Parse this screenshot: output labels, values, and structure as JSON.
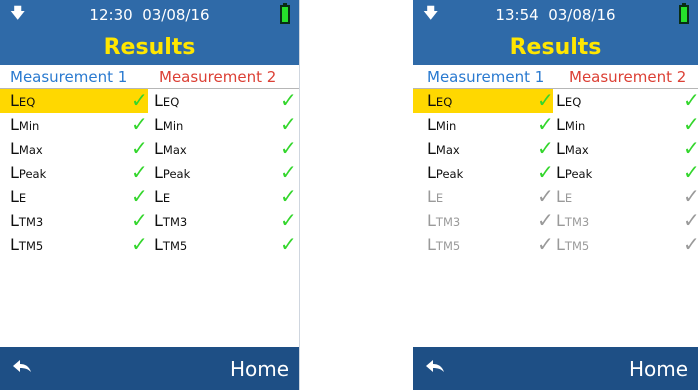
{
  "screen1": {
    "time": "12:30",
    "date": "03/08/16",
    "title": "Results",
    "header1": "Measurement 1",
    "header2": "Measurement 2",
    "rows": [
      {
        "main": "L",
        "sub": "EQ"
      },
      {
        "main": "L",
        "sub": "Min"
      },
      {
        "main": "L",
        "sub": "Max"
      },
      {
        "main": "L",
        "sub": "Peak"
      },
      {
        "main": "L",
        "sub": "E"
      },
      {
        "main": "L",
        "sub": "TM3"
      },
      {
        "main": "L",
        "sub": "TM5"
      }
    ],
    "home_label": "Home"
  },
  "screen2": {
    "time": "13:54",
    "date": "03/08/16",
    "title": "Results",
    "header1": "Measurement 1",
    "header2": "Measurement 2",
    "rows": [
      {
        "main": "L",
        "sub": "EQ"
      },
      {
        "main": "L",
        "sub": "Min"
      },
      {
        "main": "L",
        "sub": "Max"
      },
      {
        "main": "L",
        "sub": "Peak"
      },
      {
        "main": "L",
        "sub": "E"
      },
      {
        "main": "L",
        "sub": "TM3"
      },
      {
        "main": "L",
        "sub": "TM5"
      }
    ],
    "home_label": "Home"
  },
  "check_glyph": "✓",
  "colors": {
    "header_bg": "#2f6aa8",
    "title_text": "#ffe600",
    "highlight": "#ffd800",
    "check_active": "#33d62c",
    "check_dim": "#9a9a9a",
    "measurement1": "#2a7ad0",
    "measurement2": "#dc4035",
    "footer_bg": "#1e4f85",
    "battery": "#26e12b"
  },
  "icons": {
    "status_download": "download-arrow-icon",
    "battery": "battery-icon",
    "check": "check-icon",
    "back": "back-arrow-icon"
  }
}
